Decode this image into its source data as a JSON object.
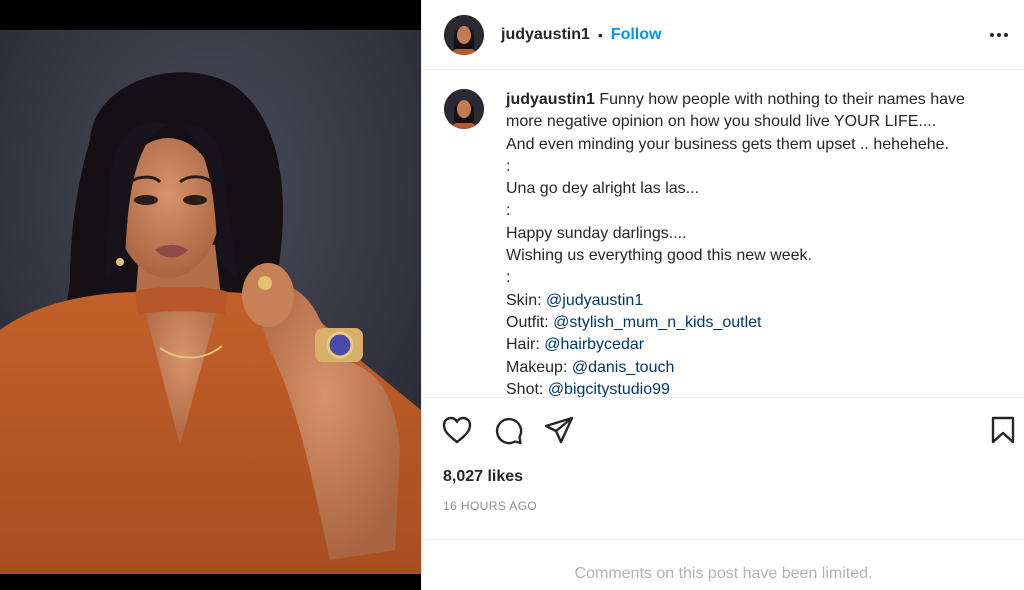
{
  "header": {
    "username": "judyaustin1",
    "separator": "•",
    "follow_label": "Follow",
    "more_icon": "more-horizontal-icon"
  },
  "caption": {
    "username": "judyaustin1",
    "lines": [
      "Funny how people with nothing to their names have",
      "more negative opinion on how you should live YOUR LIFE....",
      "And even minding your business gets them upset .. hehehehe.",
      ":",
      "Una go dey alright las las...",
      ":",
      "Happy sunday darlings....",
      "Wishing us everything good this new week.",
      ":"
    ],
    "credits": [
      {
        "label": "Skin:",
        "handle": "@judyaustin1"
      },
      {
        "label": "Outfit:",
        "handle": "@stylish_mum_n_kids_outlet"
      },
      {
        "label": "Hair:",
        "handle": "@hairbycedar"
      },
      {
        "label": "Makeup:",
        "handle": "@danis_touch"
      },
      {
        "label": "Shot:",
        "handle": "@bigcitystudio99"
      }
    ]
  },
  "actions": {
    "like_icon": "heart-icon",
    "comment_icon": "comment-icon",
    "share_icon": "paper-plane-icon",
    "save_icon": "bookmark-icon"
  },
  "likes": "8,027 likes",
  "timestamp": "16 HOURS AGO",
  "comments_notice": "Comments on this post have been limited.",
  "colors": {
    "accent": "#0095f6",
    "mention": "#00376b",
    "text": "#262626",
    "muted": "#8e8e8e"
  }
}
